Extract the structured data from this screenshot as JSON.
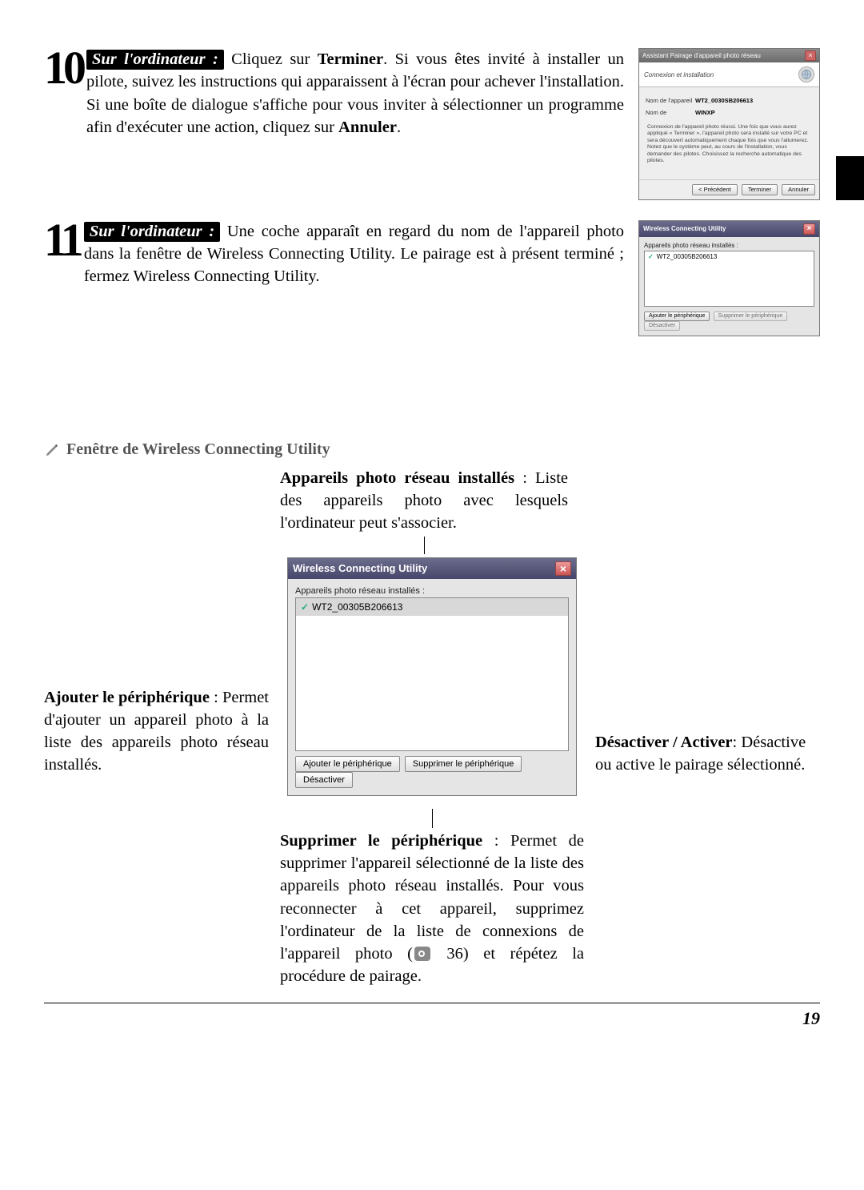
{
  "steps": [
    {
      "num": "10",
      "tag": "Sur l'ordinateur :",
      "text_before": "Cliquez sur ",
      "text_bold1": "Terminer",
      "text_mid": ". Si vous êtes invité à installer un pilote, suivez les instructions qui apparaissent à l'écran pour achever l'installation. Si une boîte de dialogue s'affiche pour vous inviter à sélectionner un programme afin d'exécuter une action, cliquez sur ",
      "text_bold2": "Annuler",
      "text_after": "."
    },
    {
      "num": "11",
      "tag": "Sur l'ordinateur :",
      "text_before": "Une coche apparaît en regard du nom de l'appareil photo dans la fenêtre de Wireless Connecting Utility. Le pairage est à présent terminé ; fermez Wireless Connecting Utility.",
      "text_bold1": "",
      "text_mid": "",
      "text_bold2": "",
      "text_after": ""
    }
  ],
  "wizard": {
    "title": "Assistant Pairage d'appareil photo réseau",
    "subtitle": "Connexion et installation",
    "label_device": "Nom de l'appareil",
    "value_device": "WT2_0030SB206613",
    "label_host": "Nom de",
    "value_host": "WINXP",
    "blurb": "Connexion de l'appareil photo réussi. Une fois que vous aurez appliqué « Terminer », l'appareil photo sera installé sur votre PC et sera découvert automatiquement chaque fois que vous l'allumerez. Notez que le système peut, au cours de l'installation, vous demander des pilotes. Choisissez la recherche automatique des pilotes.",
    "btn_back": "< Précédent",
    "btn_finish": "Terminer",
    "btn_cancel": "Annuler"
  },
  "util": {
    "title": "Wireless Connecting Utility",
    "list_label": "Appareils photo réseau installés :",
    "item": "WT2_00305B206613",
    "btn_add": "Ajouter le périphérique",
    "btn_remove": "Supprimer le périphérique",
    "btn_disable": "Désactiver"
  },
  "section_title": "Fenêtre de Wireless Connecting Utility",
  "callouts": {
    "top_bold": "Appareils photo réseau installés",
    "top_rest": " : Liste des appareils photo avec lesquels l'ordinateur peut s'associer.",
    "left_bold": "Ajouter le périphérique",
    "left_rest": " : Permet d'ajouter un appareil photo à la liste des appareils photo réseau installés.",
    "right_bold": "Désactiver / Activer",
    "right_rest": ": Désactive ou active le pairage sélectionné.",
    "bottom_bold": "Supprimer le périphérique",
    "bottom_rest1": " : Permet de supprimer l'appareil sélectionné de la liste des appareils photo réseau installés. Pour vous reconnecter à cet appareil, supprimez l'ordinateur de la liste de connexions de l'appareil photo (",
    "bottom_ref": "36",
    "bottom_rest2": ") et répétez la procédure de pairage."
  },
  "page_number": "19"
}
